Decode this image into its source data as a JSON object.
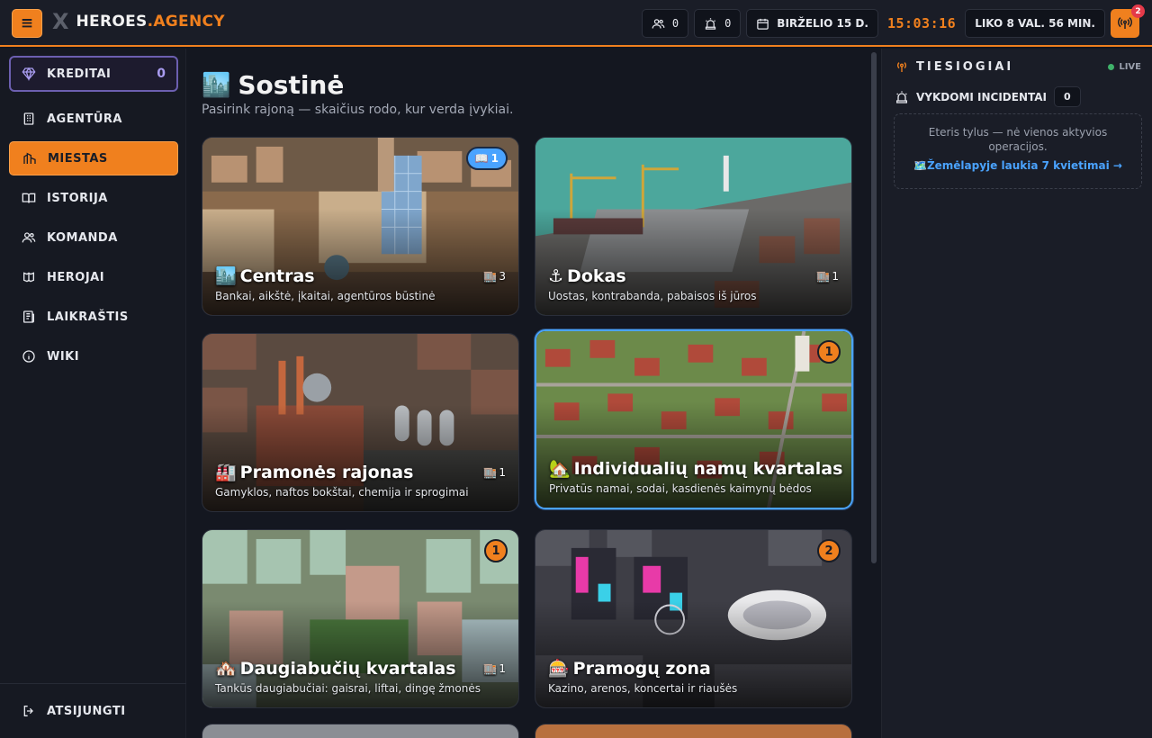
{
  "header": {
    "menu_icon": "≡",
    "logo_mark": "X",
    "brand_main": "HEROES",
    "brand_accent": ".AGENCY",
    "team_count": "0",
    "incidents_count": "0",
    "date": "BIRŽELIO 15 D.",
    "clock": "15:03:16",
    "time_left": "LIKO 8 VAL. 56 MIN.",
    "alerts_badge": "2"
  },
  "sidebar": {
    "credits_label": "KREDITAI",
    "credits_value": "0",
    "items": [
      {
        "label": "AGENTŪRA",
        "icon": "building-icon"
      },
      {
        "label": "MIESTAS",
        "icon": "city-icon",
        "active": true
      },
      {
        "label": "ISTORIJA",
        "icon": "book-icon"
      },
      {
        "label": "KOMANDA",
        "icon": "users-icon"
      },
      {
        "label": "HEROJAI",
        "icon": "heroes-icon"
      },
      {
        "label": "LAIKRAŠTIS",
        "icon": "newspaper-icon"
      },
      {
        "label": "WIKI",
        "icon": "info-icon"
      }
    ],
    "logout_label": "ATSIJUNGTI"
  },
  "main": {
    "title_icon": "🏙️",
    "title": "Sostinė",
    "subtitle": "Pasirink rajoną — skaičius rodo, kur verda įvykiai.",
    "districts": [
      {
        "emoji": "🏙️",
        "name": "Centras",
        "desc": "Bankai, aikštė, įkaitai, agentūros būstinė",
        "heroes": "3",
        "story": "1"
      },
      {
        "emoji": "⚓",
        "name": "Dokas",
        "desc": "Uostas, kontrabanda, pabaisos iš jūros",
        "heroes": "1"
      },
      {
        "emoji": "🏭",
        "name": "Pramonės rajonas",
        "desc": "Gamyklos, naftos bokštai, chemija ir sprogimai",
        "heroes": "1"
      },
      {
        "emoji": "🏡",
        "name": "Individualių namų kvartalas",
        "desc": "Privatūs namai, sodai, kasdienės kaimynų bėdos",
        "badge": "1"
      },
      {
        "emoji": "🏘️",
        "name": "Daugiabučių kvartalas",
        "desc": "Tankūs daugiabučiai: gaisrai, liftai, dingę žmonės",
        "heroes": "1",
        "badge": "1"
      },
      {
        "emoji": "🎰",
        "name": "Pramogų zona",
        "desc": "Kazino, arenos, koncertai ir riaušės",
        "badge": "2"
      }
    ]
  },
  "right": {
    "title": "TIESIOGIAI",
    "live": "LIVE",
    "incidents_label": "VYKDOMI INCIDENTAI",
    "incidents_value": "0",
    "empty_msg": "Eteris tylus — nė vienos aktyvios operacijos.",
    "invites_link": "🗺️Žemėlapyje laukia 7 kvietimai →"
  }
}
